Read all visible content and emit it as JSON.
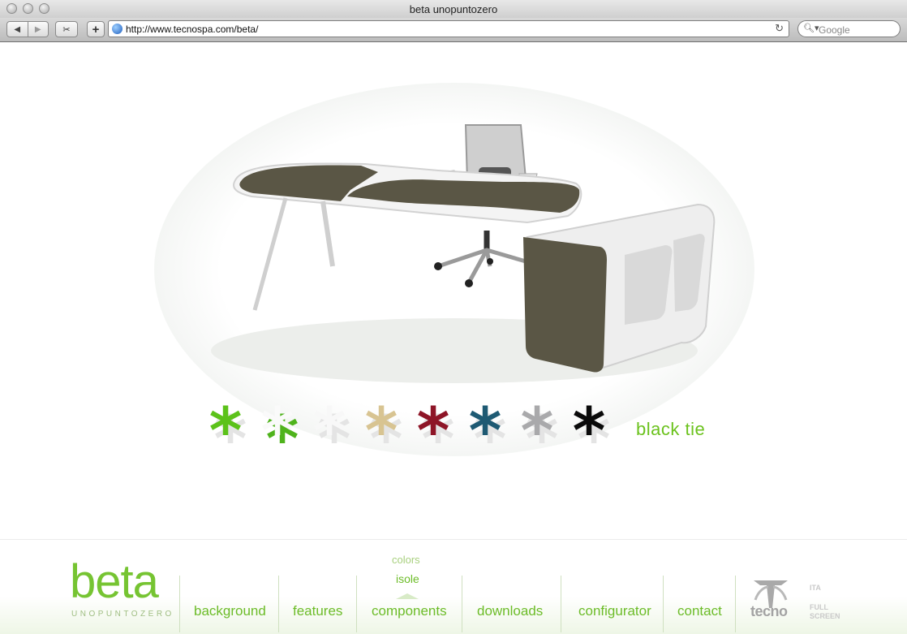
{
  "window": {
    "title": "beta unopuntozero"
  },
  "toolbar": {
    "back_icon": "back-arrow-icon",
    "forward_icon": "forward-arrow-icon",
    "url": "http://www.tecnospa.com/beta/",
    "search_placeholder": "Google"
  },
  "swatches": [
    {
      "name": "green",
      "color": "#5cc21a"
    },
    {
      "name": "white-green",
      "color": "#4fb31c"
    },
    {
      "name": "white",
      "color": "#f8f8f8"
    },
    {
      "name": "beige",
      "color": "#d8c492"
    },
    {
      "name": "burgundy",
      "color": "#8e1527"
    },
    {
      "name": "teal",
      "color": "#1e5a73"
    },
    {
      "name": "grey",
      "color": "#a9a9ab"
    },
    {
      "name": "black",
      "color": "#0a0a0a"
    }
  ],
  "selected_color": "black tie",
  "footer": {
    "logo": "beta",
    "logo_sub": "UNOPUNTOZERO",
    "nav": [
      "background",
      "features",
      "components",
      "downloads",
      "configurator",
      "contact"
    ],
    "submenu": [
      "colors",
      "isole"
    ],
    "brand": "tecno",
    "lang": "ITA",
    "fullscreen": "FULL SCREEN"
  },
  "colors": {
    "accent": "#6cbc28",
    "desk_brown": "#5a5645"
  }
}
